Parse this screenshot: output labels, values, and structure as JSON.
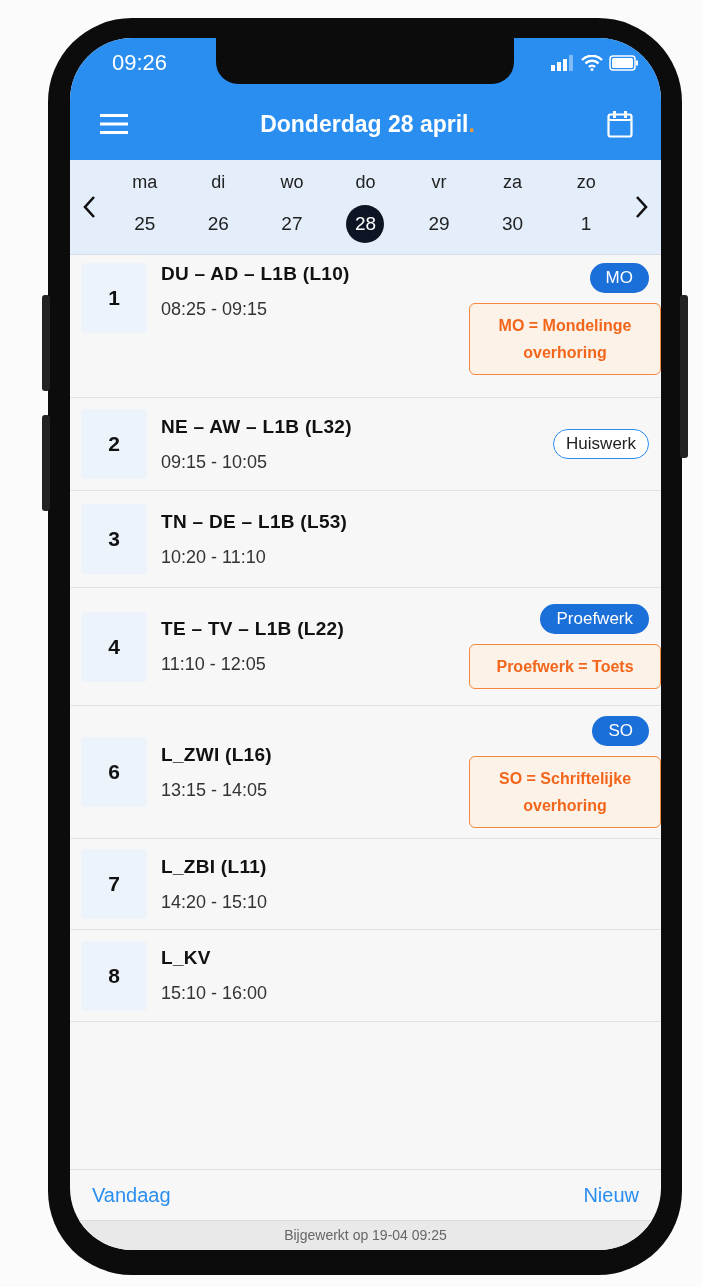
{
  "status_bar": {
    "time": "09:26"
  },
  "header": {
    "title": "Donderdag 28 april",
    "title_dot": "."
  },
  "week": {
    "days": [
      {
        "name": "ma",
        "number": "25",
        "selected": false
      },
      {
        "name": "di",
        "number": "26",
        "selected": false
      },
      {
        "name": "wo",
        "number": "27",
        "selected": false
      },
      {
        "name": "do",
        "number": "28",
        "selected": true
      },
      {
        "name": "vr",
        "number": "29",
        "selected": false
      },
      {
        "name": "za",
        "number": "30",
        "selected": false
      },
      {
        "name": "zo",
        "number": "1",
        "selected": false
      }
    ]
  },
  "lessons": [
    {
      "period": "1",
      "title": "DU – AD – L1B (L10)",
      "time": "08:25 - 09:15",
      "badge": {
        "label": "MO",
        "kind": "filled"
      },
      "note": "MO = Mondelinge overhoring"
    },
    {
      "period": "2",
      "title": "NE – AW – L1B (L32)",
      "time": "09:15 - 10:05",
      "badge": {
        "label": "Huiswerk",
        "kind": "outline"
      }
    },
    {
      "period": "3",
      "title": "TN – DE – L1B (L53)",
      "time": "10:20 - 11:10"
    },
    {
      "period": "4",
      "title": "TE – TV – L1B (L22)",
      "time": "11:10 - 12:05",
      "badge": {
        "label": "Proefwerk",
        "kind": "filled"
      },
      "note": "Proefwerk = Toets"
    },
    {
      "period": "6",
      "title": "L_ZWI (L16)",
      "time": "13:15 - 14:05",
      "badge": {
        "label": "SO",
        "kind": "filled"
      },
      "note": "SO = Schriftelijke overhoring"
    },
    {
      "period": "7",
      "title": "L_ZBI (L11)",
      "time": "14:20 - 15:10"
    },
    {
      "period": "8",
      "title": "L_KV",
      "time": "15:10 - 16:00"
    }
  ],
  "footer": {
    "left_button": "Vandaag",
    "right_button": "Nieuw",
    "updated": "Bijgewerkt op 19-04 09:25"
  }
}
